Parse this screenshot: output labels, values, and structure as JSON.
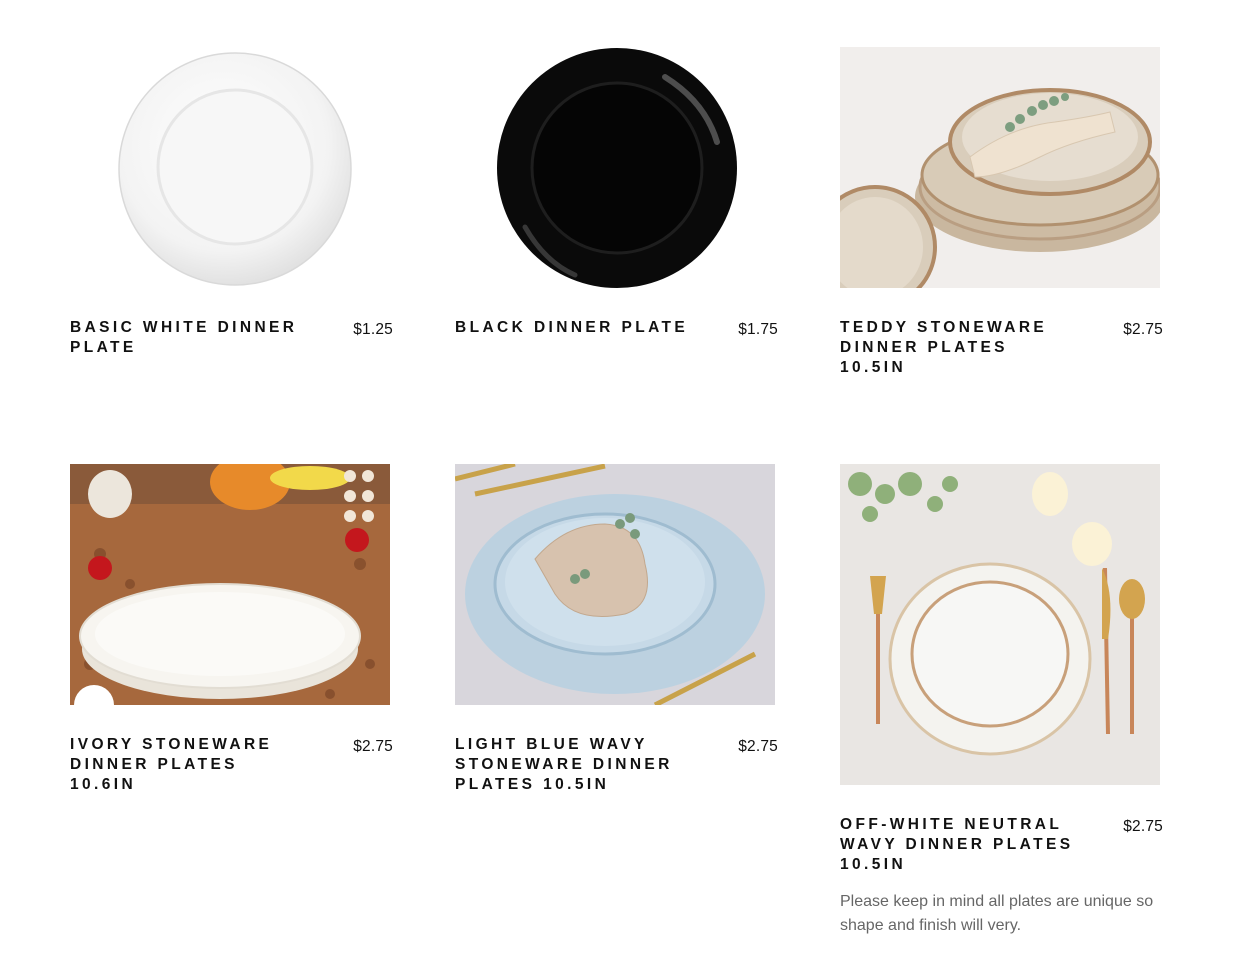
{
  "products": [
    {
      "title": "Basic White Dinner Plate",
      "price": "$1.25"
    },
    {
      "title": "Black Dinner Plate",
      "price": "$1.75"
    },
    {
      "title": "Teddy Stoneware Dinner Plates 10.5in",
      "price": "$2.75"
    },
    {
      "title": "Ivory Stoneware Dinner Plates 10.6in",
      "price": "$2.75"
    },
    {
      "title": "Light Blue Wavy Stoneware Dinner Plates 10.5in",
      "price": "$2.75"
    },
    {
      "title": "Off-White Neutral Wavy Dinner Plates 10.5in",
      "price": "$2.75",
      "note": "Please keep in mind all plates are unique so shape and finish will very."
    }
  ]
}
